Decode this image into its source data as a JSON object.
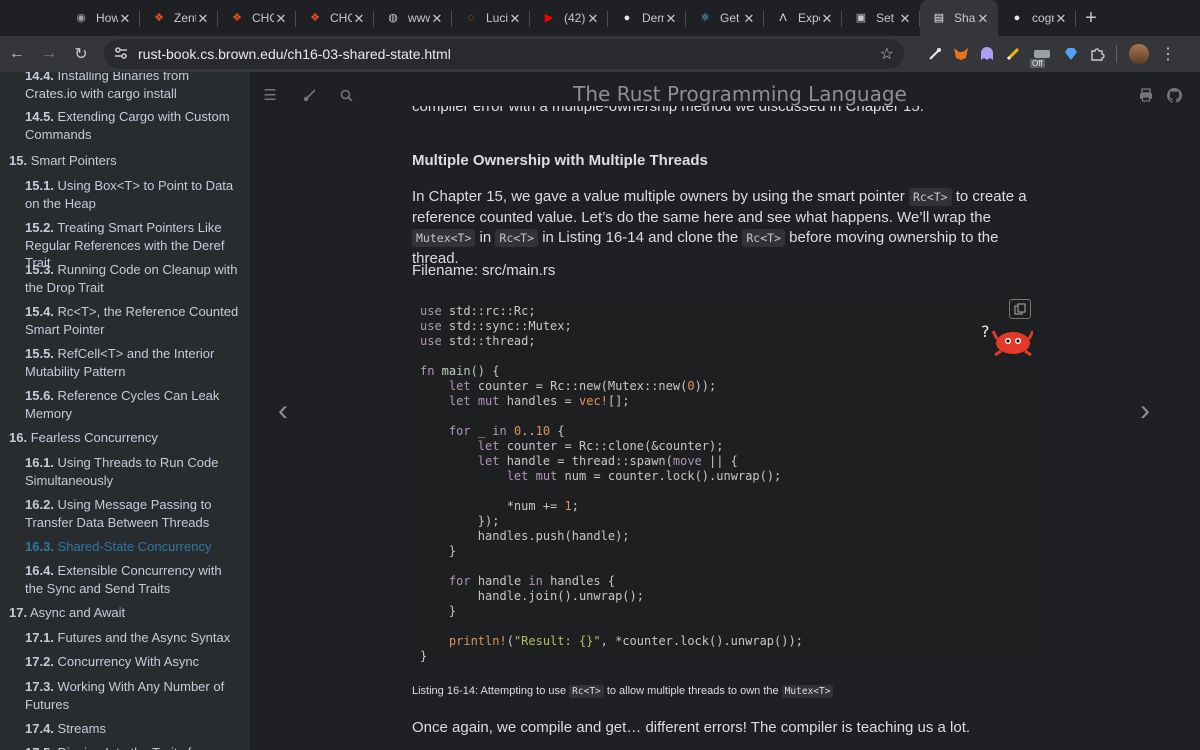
{
  "browser": {
    "tabs": [
      {
        "label": "How",
        "icon": "chrome-icon"
      },
      {
        "label": "Zent",
        "icon": "figma-icon"
      },
      {
        "label": "CHC",
        "icon": "figma-icon"
      },
      {
        "label": "CHC",
        "icon": "figma-icon"
      },
      {
        "label": "www",
        "icon": "globe-icon"
      },
      {
        "label": "Luci",
        "icon": "lucid-icon"
      },
      {
        "label": "(42)",
        "icon": "youtube-icon"
      },
      {
        "label": "Dem",
        "icon": "github-icon"
      },
      {
        "label": "Get",
        "icon": "react-icon"
      },
      {
        "label": "Expo",
        "icon": "expo-icon"
      },
      {
        "label": "Set",
        "icon": "cube-icon"
      },
      {
        "label": "Shar",
        "icon": "book-icon",
        "active": true
      },
      {
        "label": "cogr",
        "icon": "github-icon"
      }
    ],
    "close_glyph": "✕",
    "new_tab": "+",
    "url": "rust-book.cs.brown.edu/ch16-03-shared-state.html",
    "extension_off_badge": "Off"
  },
  "sidebar": {
    "items": [
      {
        "num": "14.4.",
        "label": "Installing Binaries from Crates.io with cargo install"
      },
      {
        "num": "14.5.",
        "label": "Extending Cargo with Custom Commands"
      },
      {
        "num": "15.",
        "label": "Smart Pointers"
      },
      {
        "num": "15.1.",
        "label": "Using Box<T> to Point to Data on the Heap"
      },
      {
        "num": "15.2.",
        "label": "Treating Smart Pointers Like Regular References with the Deref Trait"
      },
      {
        "num": "15.3.",
        "label": "Running Code on Cleanup with the Drop Trait"
      },
      {
        "num": "15.4.",
        "label": "Rc<T>, the Reference Counted Smart Pointer"
      },
      {
        "num": "15.5.",
        "label": "RefCell<T> and the Interior Mutability Pattern"
      },
      {
        "num": "15.6.",
        "label": "Reference Cycles Can Leak Memory"
      },
      {
        "num": "16.",
        "label": "Fearless Concurrency"
      },
      {
        "num": "16.1.",
        "label": "Using Threads to Run Code Simultaneously"
      },
      {
        "num": "16.2.",
        "label": "Using Message Passing to Transfer Data Between Threads"
      },
      {
        "num": "16.3.",
        "label": "Shared-State Concurrency"
      },
      {
        "num": "16.4.",
        "label": "Extensible Concurrency with the Sync and Send Traits"
      },
      {
        "num": "17.",
        "label": "Async and Await"
      },
      {
        "num": "17.1.",
        "label": "Futures and the Async Syntax"
      },
      {
        "num": "17.2.",
        "label": "Concurrency With Async"
      },
      {
        "num": "17.3.",
        "label": "Working With Any Number of Futures"
      },
      {
        "num": "17.4.",
        "label": "Streams"
      },
      {
        "num": "17.5.",
        "label": "Digging Into the Traits for Async"
      }
    ]
  },
  "header": {
    "title": "The Rust Programming Language"
  },
  "content": {
    "cut_text": "compiler error with a multiple-ownership method we discussed in Chapter 15.",
    "heading": "Multiple Ownership with Multiple Threads",
    "p1": [
      "In Chapter 15, we gave a value multiple owners by using the smart pointer ",
      "Rc<T>",
      " to create a reference counted value. Let’s do the same here and see what happens. We’ll wrap the ",
      "Mutex<T>",
      " in ",
      "Rc<T>",
      " in Listing 16-14 and clone the ",
      "Rc<T>",
      " before moving ownership to the thread."
    ],
    "filename": "Filename: src/main.rs",
    "code_lines": [
      "use std::rc::Rc;",
      "use std::sync::Mutex;",
      "use std::thread;",
      "",
      "fn main() {",
      "    let counter = Rc::new(Mutex::new(0));",
      "    let mut handles = vec![];",
      "",
      "    for _ in 0..10 {",
      "        let counter = Rc::clone(&counter);",
      "        let handle = thread::spawn(move || {",
      "            let mut num = counter.lock().unwrap();",
      "",
      "            *num += 1;",
      "        });",
      "        handles.push(handle);",
      "    }",
      "",
      "    for handle in handles {",
      "        handle.join().unwrap();",
      "    }",
      "",
      "    println!(\"Result: {}\", *counter.lock().unwrap());",
      "}"
    ],
    "ferris_question": "?",
    "caption": [
      "Listing 16-14: Attempting to use ",
      "Rc<T>",
      " to allow multiple threads to own the ",
      "Mutex<T>"
    ],
    "p2": "Once again, we compile and get… different errors! The compiler is teaching us a lot."
  }
}
